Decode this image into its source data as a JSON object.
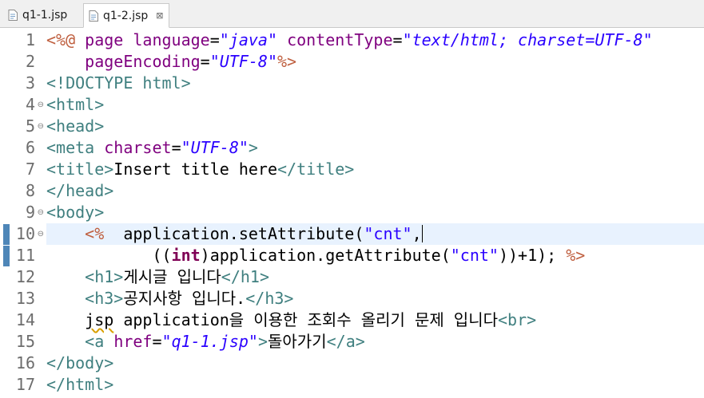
{
  "tabs": [
    {
      "label": "q1-1.jsp",
      "active": false
    },
    {
      "label": "q1-2.jsp",
      "active": true,
      "close_icon": "close-icon"
    }
  ],
  "colors": {
    "directive": "#bf5f3f",
    "tag": "#3f7f7f",
    "attribute": "#7f007f",
    "value": "#2a00ff",
    "keyword": "#7f0055",
    "current_line": "#e8f2fe",
    "change_bar": "#4e86b8"
  },
  "editor": {
    "current_line": 10,
    "lines": [
      {
        "n": "1",
        "fold": "",
        "tokens": [
          [
            "d",
            "<%@"
          ],
          [
            "x",
            " "
          ],
          [
            "a",
            "page"
          ],
          [
            "x",
            " "
          ],
          [
            "a",
            "language"
          ],
          [
            "x",
            "="
          ],
          [
            "v",
            "\"java\""
          ],
          [
            "x",
            " "
          ],
          [
            "a",
            "contentType"
          ],
          [
            "x",
            "="
          ],
          [
            "v",
            "\"text/html; charset=UTF-8\""
          ]
        ]
      },
      {
        "n": "2",
        "fold": "",
        "tokens": [
          [
            "x",
            "    "
          ],
          [
            "a",
            "pageEncoding"
          ],
          [
            "x",
            "="
          ],
          [
            "v",
            "\"UTF-8\""
          ],
          [
            "d",
            "%>"
          ]
        ]
      },
      {
        "n": "3",
        "fold": "",
        "tokens": [
          [
            "t",
            "<!DOCTYPE"
          ],
          [
            "x",
            " "
          ],
          [
            "t",
            "html"
          ],
          [
            "t",
            ">"
          ]
        ]
      },
      {
        "n": "4",
        "fold": "⊖",
        "tokens": [
          [
            "t",
            "<html>"
          ]
        ]
      },
      {
        "n": "5",
        "fold": "⊖",
        "tokens": [
          [
            "t",
            "<head>"
          ]
        ]
      },
      {
        "n": "6",
        "fold": "",
        "tokens": [
          [
            "t",
            "<meta"
          ],
          [
            "x",
            " "
          ],
          [
            "a",
            "charset"
          ],
          [
            "x",
            "="
          ],
          [
            "v",
            "\"UTF-8\""
          ],
          [
            "t",
            ">"
          ]
        ]
      },
      {
        "n": "7",
        "fold": "",
        "tokens": [
          [
            "t",
            "<title>"
          ],
          [
            "x",
            "Insert title here"
          ],
          [
            "t",
            "</title>"
          ]
        ]
      },
      {
        "n": "8",
        "fold": "",
        "tokens": [
          [
            "t",
            "</head>"
          ]
        ]
      },
      {
        "n": "9",
        "fold": "⊖",
        "tokens": [
          [
            "t",
            "<body>"
          ]
        ]
      },
      {
        "n": "10",
        "fold": "⊖",
        "tokens": [
          [
            "x",
            "    "
          ],
          [
            "d",
            "<%"
          ],
          [
            "x",
            "  application.setAttribute("
          ],
          [
            "s",
            "\"cnt\""
          ],
          [
            "x",
            ","
          ]
        ]
      },
      {
        "n": "11",
        "fold": "",
        "tokens": [
          [
            "x",
            "           (("
          ],
          [
            "k",
            "int"
          ],
          [
            "x",
            ")application.getAttribute("
          ],
          [
            "s",
            "\"cnt\""
          ],
          [
            "x",
            "))+1); "
          ],
          [
            "d",
            "%>"
          ]
        ]
      },
      {
        "n": "12",
        "fold": "",
        "tokens": [
          [
            "x",
            "    "
          ],
          [
            "t",
            "<h1>"
          ],
          [
            "x",
            "게시글 입니다"
          ],
          [
            "t",
            "</h1>"
          ]
        ]
      },
      {
        "n": "13",
        "fold": "",
        "tokens": [
          [
            "x",
            "    "
          ],
          [
            "t",
            "<h3>"
          ],
          [
            "x",
            "공지사항 입니다."
          ],
          [
            "t",
            "</h3>"
          ]
        ]
      },
      {
        "n": "14",
        "fold": "",
        "tokens": [
          [
            "x",
            "    "
          ],
          [
            "j",
            "jsp"
          ],
          [
            "x",
            " application을 이용한 조회수 올리기 문제 입니다"
          ],
          [
            "t",
            "<br>"
          ]
        ]
      },
      {
        "n": "15",
        "fold": "",
        "tokens": [
          [
            "x",
            "    "
          ],
          [
            "t",
            "<a"
          ],
          [
            "x",
            " "
          ],
          [
            "a",
            "href"
          ],
          [
            "x",
            "="
          ],
          [
            "v",
            "\"q1-1.jsp\""
          ],
          [
            "t",
            ">"
          ],
          [
            "x",
            "돌아가기"
          ],
          [
            "t",
            "</a>"
          ]
        ]
      },
      {
        "n": "16",
        "fold": "",
        "tokens": [
          [
            "t",
            "</body>"
          ]
        ]
      },
      {
        "n": "17",
        "fold": "",
        "tokens": [
          [
            "t",
            "</html>"
          ]
        ]
      }
    ]
  }
}
